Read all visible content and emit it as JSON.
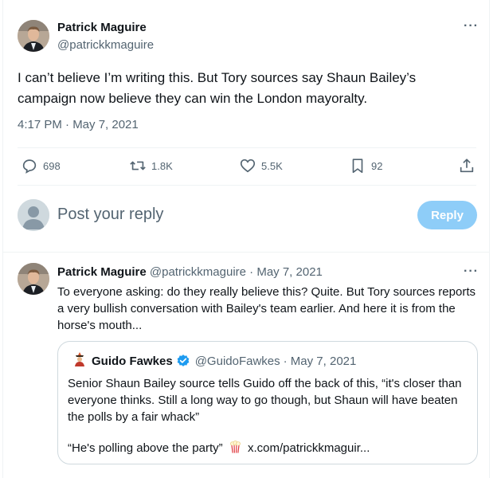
{
  "main_tweet": {
    "author_name": "Patrick Maguire",
    "author_handle": "@patrickkmaguire",
    "more_label": "···",
    "text": "I can’t believe I’m writing this. But Tory sources say Shaun Bailey’s campaign now believe they can win the London mayoralty.",
    "timestamp": "4:17 PM · May 7, 2021",
    "stats": {
      "replies": "698",
      "retweets": "1.8K",
      "likes": "5.5K",
      "bookmarks": "92"
    },
    "icons": [
      "reply-icon",
      "retweet-icon",
      "like-icon",
      "bookmark-icon",
      "share-icon"
    ]
  },
  "reply_composer": {
    "placeholder": "Post your reply",
    "button_label": "Reply",
    "button_color": "#8ecdf8"
  },
  "second_tweet": {
    "author_name": "Patrick Maguire",
    "author_handle": "@patrickkmaguire",
    "date": "· May 7, 2021",
    "more_label": "···",
    "text": "To everyone asking: do they really believe this? Quite. But Tory sources reports a very bullish conversation with Bailey's team earlier. And here it is from the horse's mouth..."
  },
  "quoted_tweet": {
    "author_name": "Guido Fawkes",
    "author_handle": "@GuidoFawkes",
    "date": "· May 7, 2021",
    "text": "Senior Shaun Bailey source tells Guido off the back of this, “it's closer than everyone thinks. Still a long way to go though, but Shaun will have beaten the polls by a fair whack”",
    "text2_prefix": "“He's polling above the party”",
    "link": "x.com/patrickkmaguir..."
  },
  "colors": {
    "text_primary": "#0f1419",
    "text_secondary": "#536471",
    "verified": "#1d9bf0",
    "border": "#eff3f4"
  }
}
